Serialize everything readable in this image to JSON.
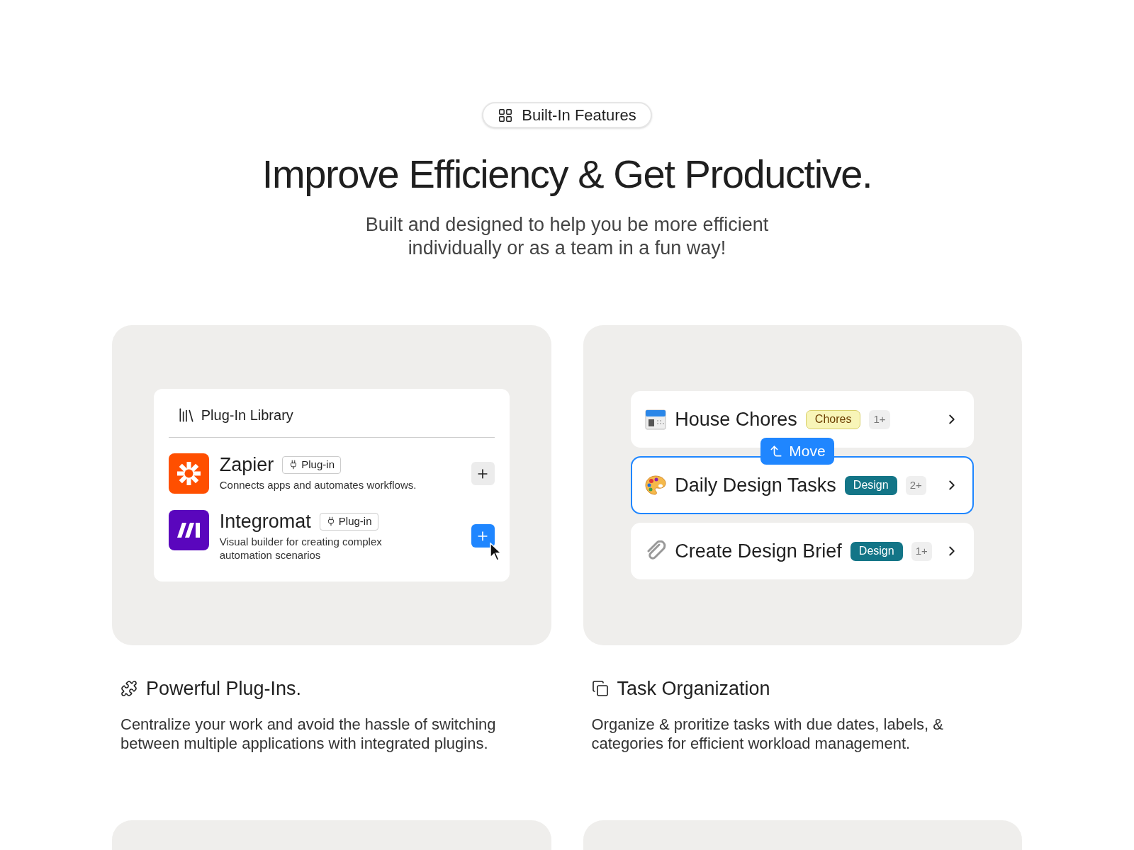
{
  "badge": {
    "label": "Built-In Features"
  },
  "heading": "Improve Efficiency & Get Productive.",
  "subheading": [
    "Built and designed to help you be more efficient",
    "individually or as a team in a fun way!"
  ],
  "plugin_library": {
    "title": "Plug-In Library",
    "plugins": [
      {
        "name": "Zapier",
        "tag": "Plug-in",
        "description": "Connects apps and automates workflows.",
        "active": false
      },
      {
        "name": "Integromat",
        "tag": "Plug-in",
        "description": "Visual builder for creating complex automation scenarios",
        "active": true
      }
    ]
  },
  "tasks": {
    "move_label": "Move",
    "items": [
      {
        "title": "House Chores",
        "tag": "Chores",
        "color": "#f8f5b8",
        "count": "1+",
        "selected": false
      },
      {
        "title": "Daily Design Tasks",
        "tag": "Design",
        "color": "#137587",
        "count": "2+",
        "selected": true
      },
      {
        "title": "Create Design Brief",
        "tag": "Design",
        "color": "#137587",
        "count": "1+",
        "selected": false
      }
    ]
  },
  "features": [
    {
      "title": "Powerful Plug-Ins.",
      "text": "Centralize your work and avoid the hassle of switching between multiple applications with integrated plugins."
    },
    {
      "title": "Task Organization",
      "text": "Organize & proritize tasks with due dates, labels, & categories for efficient workload management."
    }
  ]
}
